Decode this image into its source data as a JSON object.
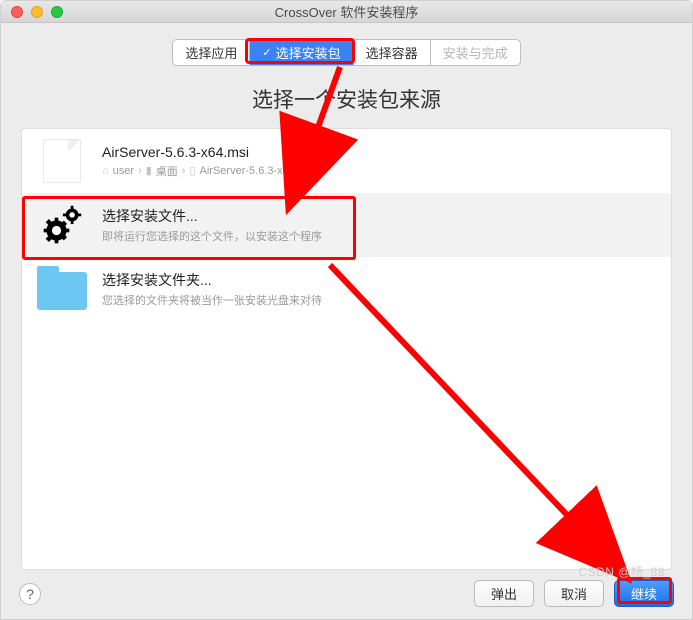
{
  "window": {
    "title": "CrossOver 软件安装程序"
  },
  "steps": [
    {
      "label": "选择应用",
      "active": false
    },
    {
      "label": "选择安装包",
      "active": true
    },
    {
      "label": "选择容器",
      "active": false
    },
    {
      "label": "安装与完成",
      "active": false,
      "disabled": true
    }
  ],
  "heading": "选择一个安装包来源",
  "options": {
    "file_item": {
      "title": "AirServer-5.6.3-x64.msi",
      "breadcrumb": [
        "user",
        "桌面",
        "AirServer-5.6.3-x64.msi"
      ],
      "home_icon": "home-icon",
      "folder_icon": "folder-mini-icon",
      "file_icon": "file-mini-icon"
    },
    "choose_file": {
      "title": "选择安装文件...",
      "subtitle": "即将运行您选择的这个文件，以安装这个程序"
    },
    "choose_folder": {
      "title": "选择安装文件夹...",
      "subtitle": "您选择的文件夹将被当作一张安装光盘来对待"
    }
  },
  "footer": {
    "help": "?",
    "eject": "弹出",
    "cancel": "取消",
    "continue": "继续"
  },
  "watermark": "CSDN @杨_88",
  "colors": {
    "accent": "#3b82f6",
    "highlight": "#ff0000"
  }
}
